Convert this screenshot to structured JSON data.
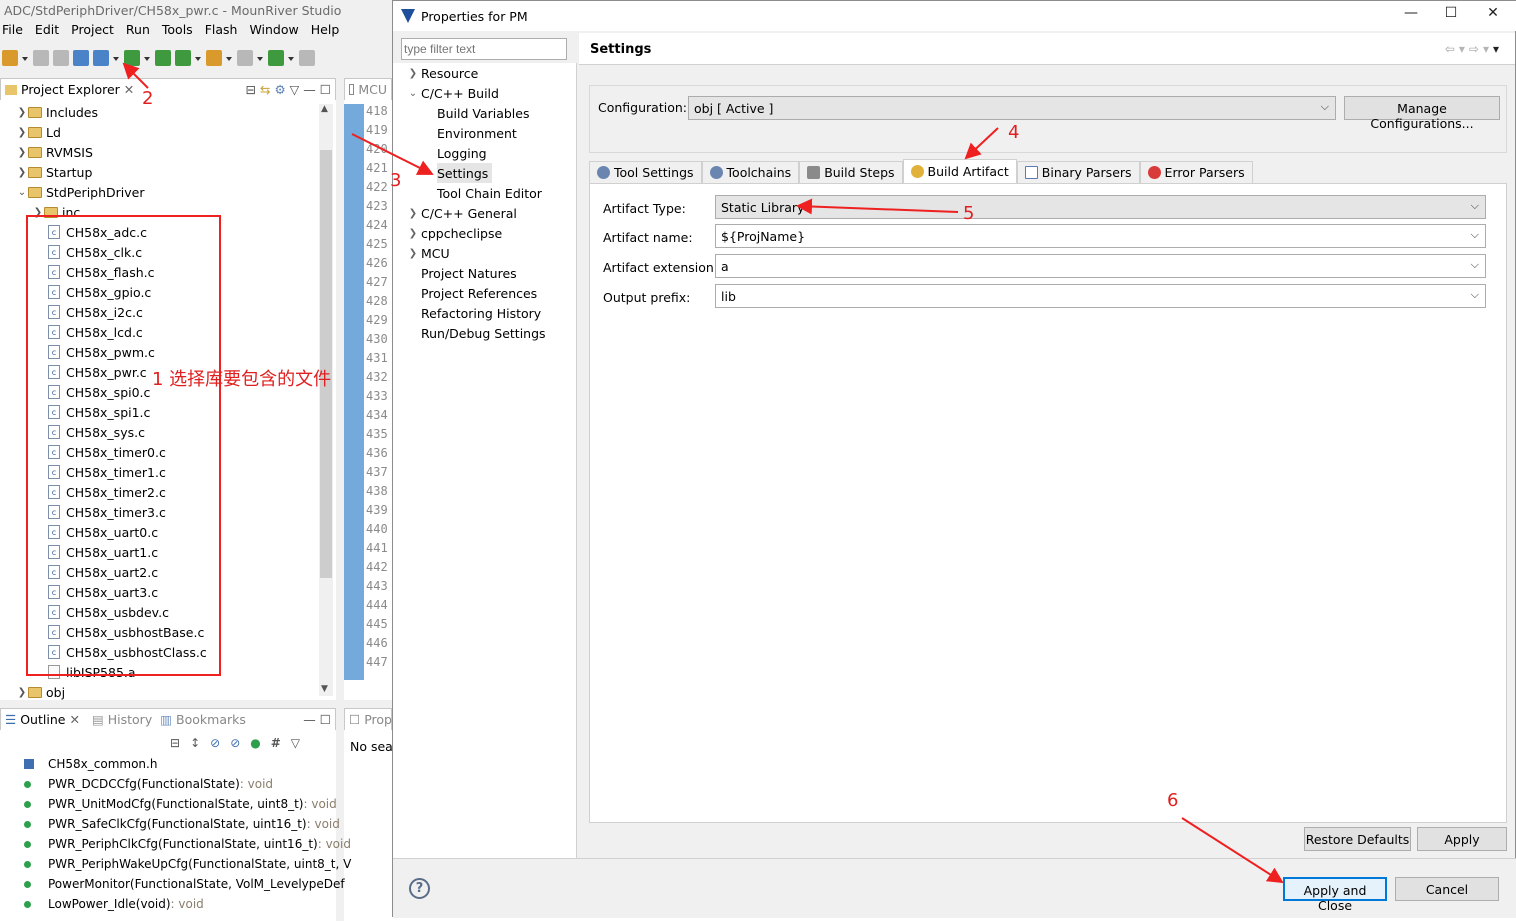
{
  "ide": {
    "title": "ADC/StdPeriphDriver/CH58x_pwr.c - MounRiver Studio",
    "menu": [
      "File",
      "Edit",
      "Project",
      "Run",
      "Tools",
      "Flash",
      "Window",
      "Help"
    ],
    "project_explorer_tab": "Project Explorer",
    "editor_tab": "MCU",
    "tree": {
      "top_items": [
        "Includes",
        "Ld",
        "RVMSIS",
        "Startup",
        "StdPeriphDriver"
      ],
      "inc": "inc",
      "files": [
        "CH58x_adc.c",
        "CH58x_clk.c",
        "CH58x_flash.c",
        "CH58x_gpio.c",
        "CH58x_i2c.c",
        "CH58x_lcd.c",
        "CH58x_pwm.c",
        "CH58x_pwr.c",
        "CH58x_spi0.c",
        "CH58x_spi1.c",
        "CH58x_sys.c",
        "CH58x_timer0.c",
        "CH58x_timer1.c",
        "CH58x_timer2.c",
        "CH58x_timer3.c",
        "CH58x_uart0.c",
        "CH58x_uart1.c",
        "CH58x_uart2.c",
        "CH58x_uart3.c",
        "CH58x_usbdev.c",
        "CH58x_usbhostBase.c",
        "CH58x_usbhostClass.c"
      ],
      "lib": "libISP585.a",
      "obj": "obj"
    },
    "line_numbers": [
      "418",
      "419",
      "420",
      "421",
      "422",
      "423",
      "424",
      "425",
      "426",
      "427",
      "428",
      "429",
      "430",
      "431",
      "432",
      "433",
      "434",
      "435",
      "436",
      "437",
      "438",
      "439",
      "440",
      "441",
      "442",
      "443",
      "444",
      "445",
      "446",
      "447"
    ],
    "bottom_tabs": [
      "Outline",
      "History",
      "Bookmarks"
    ],
    "props_tab": "Prop",
    "props_text": "No sea",
    "outline": [
      {
        "name": "CH58x_common.h",
        "type": ""
      },
      {
        "name": "PWR_DCDCCfg(FunctionalState)",
        "type": " : void"
      },
      {
        "name": "PWR_UnitModCfg(FunctionalState, uint8_t)",
        "type": " : void"
      },
      {
        "name": "PWR_SafeClkCfg(FunctionalState, uint16_t)",
        "type": " : void"
      },
      {
        "name": "PWR_PeriphClkCfg(FunctionalState, uint16_t)",
        "type": " : void"
      },
      {
        "name": "PWR_PeriphWakeUpCfg(FunctionalState, uint8_t, V",
        "type": ""
      },
      {
        "name": "PowerMonitor(FunctionalState, VolM_LevelypeDef",
        "type": ""
      },
      {
        "name": "LowPower_Idle(void)",
        "type": " : void"
      }
    ]
  },
  "dialog": {
    "title": "Properties for PM",
    "filter_placeholder": "type filter text",
    "nav": [
      "Resource",
      "C/C++ Build",
      "Build Variables",
      "Environment",
      "Logging",
      "Settings",
      "Tool Chain Editor",
      "C/C++ General",
      "cppcheclipse",
      "MCU",
      "Project Natures",
      "Project References",
      "Refactoring History",
      "Run/Debug Settings"
    ],
    "page_title": "Settings",
    "configuration_label": "Configuration:",
    "configuration_value": "obj  [ Active ]",
    "manage_button": "Manage Configurations...",
    "tabs": [
      "Tool Settings",
      "Toolchains",
      "Build Steps",
      "Build Artifact",
      "Binary Parsers",
      "Error Parsers"
    ],
    "fields": [
      {
        "label": "Artifact Type:",
        "value": "Static Library"
      },
      {
        "label": "Artifact name:",
        "value": "${ProjName}"
      },
      {
        "label": "Artifact extension:",
        "value": "a"
      },
      {
        "label": "Output prefix:",
        "value": "lib"
      }
    ],
    "restore_button": "Restore Defaults",
    "apply_button": "Apply",
    "apply_close_button": "Apply and Close",
    "cancel_button": "Cancel"
  },
  "annotations": {
    "a1": "1 选择库要包含的文件",
    "a2": "2",
    "a3": "3",
    "a4": "4",
    "a5": "5",
    "a6": "6"
  },
  "colors": {
    "annotation": "#ef2020",
    "accent": "#0078d7"
  }
}
